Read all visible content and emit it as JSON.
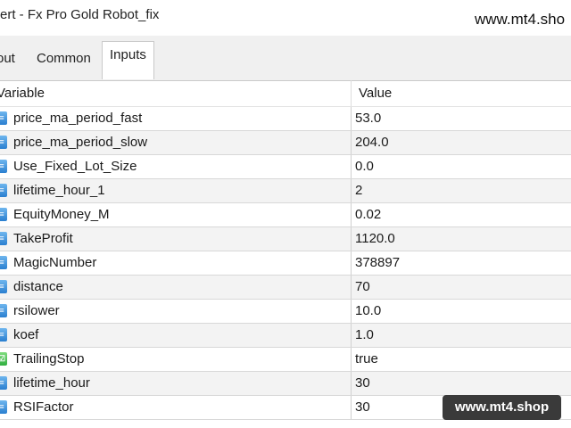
{
  "window": {
    "title": "ert - Fx Pro Gold Robot_fix"
  },
  "watermark": {
    "top": "www.mt4.sho",
    "badge": "www.mt4.shop"
  },
  "tabs": [
    {
      "label": "out",
      "active": false
    },
    {
      "label": "Common",
      "active": false
    },
    {
      "label": "Inputs",
      "active": true
    }
  ],
  "table": {
    "headers": {
      "variable": "Variable",
      "value": "Value"
    },
    "rows": [
      {
        "name": "price_ma_period_fast",
        "value": "53.0",
        "icon": "number-icon"
      },
      {
        "name": "price_ma_period_slow",
        "value": "204.0",
        "icon": "number-icon"
      },
      {
        "name": "Use_Fixed_Lot_Size",
        "value": "0.0",
        "icon": "number-icon"
      },
      {
        "name": "lifetime_hour_1",
        "value": "2",
        "icon": "number-icon"
      },
      {
        "name": "EquityMoney_M",
        "value": "0.02",
        "icon": "number-icon"
      },
      {
        "name": "TakeProfit",
        "value": "1120.0",
        "icon": "number-icon"
      },
      {
        "name": "MagicNumber",
        "value": "378897",
        "icon": "number-icon"
      },
      {
        "name": "distance",
        "value": "70",
        "icon": "number-icon"
      },
      {
        "name": "rsilower",
        "value": "10.0",
        "icon": "number-icon"
      },
      {
        "name": "koef",
        "value": "1.0",
        "icon": "number-icon"
      },
      {
        "name": "TrailingStop",
        "value": "true",
        "icon": "boolean-icon"
      },
      {
        "name": "lifetime_hour",
        "value": "30",
        "icon": "number-icon"
      },
      {
        "name": "RSIFactor",
        "value": "30",
        "icon": "number-icon"
      }
    ]
  }
}
